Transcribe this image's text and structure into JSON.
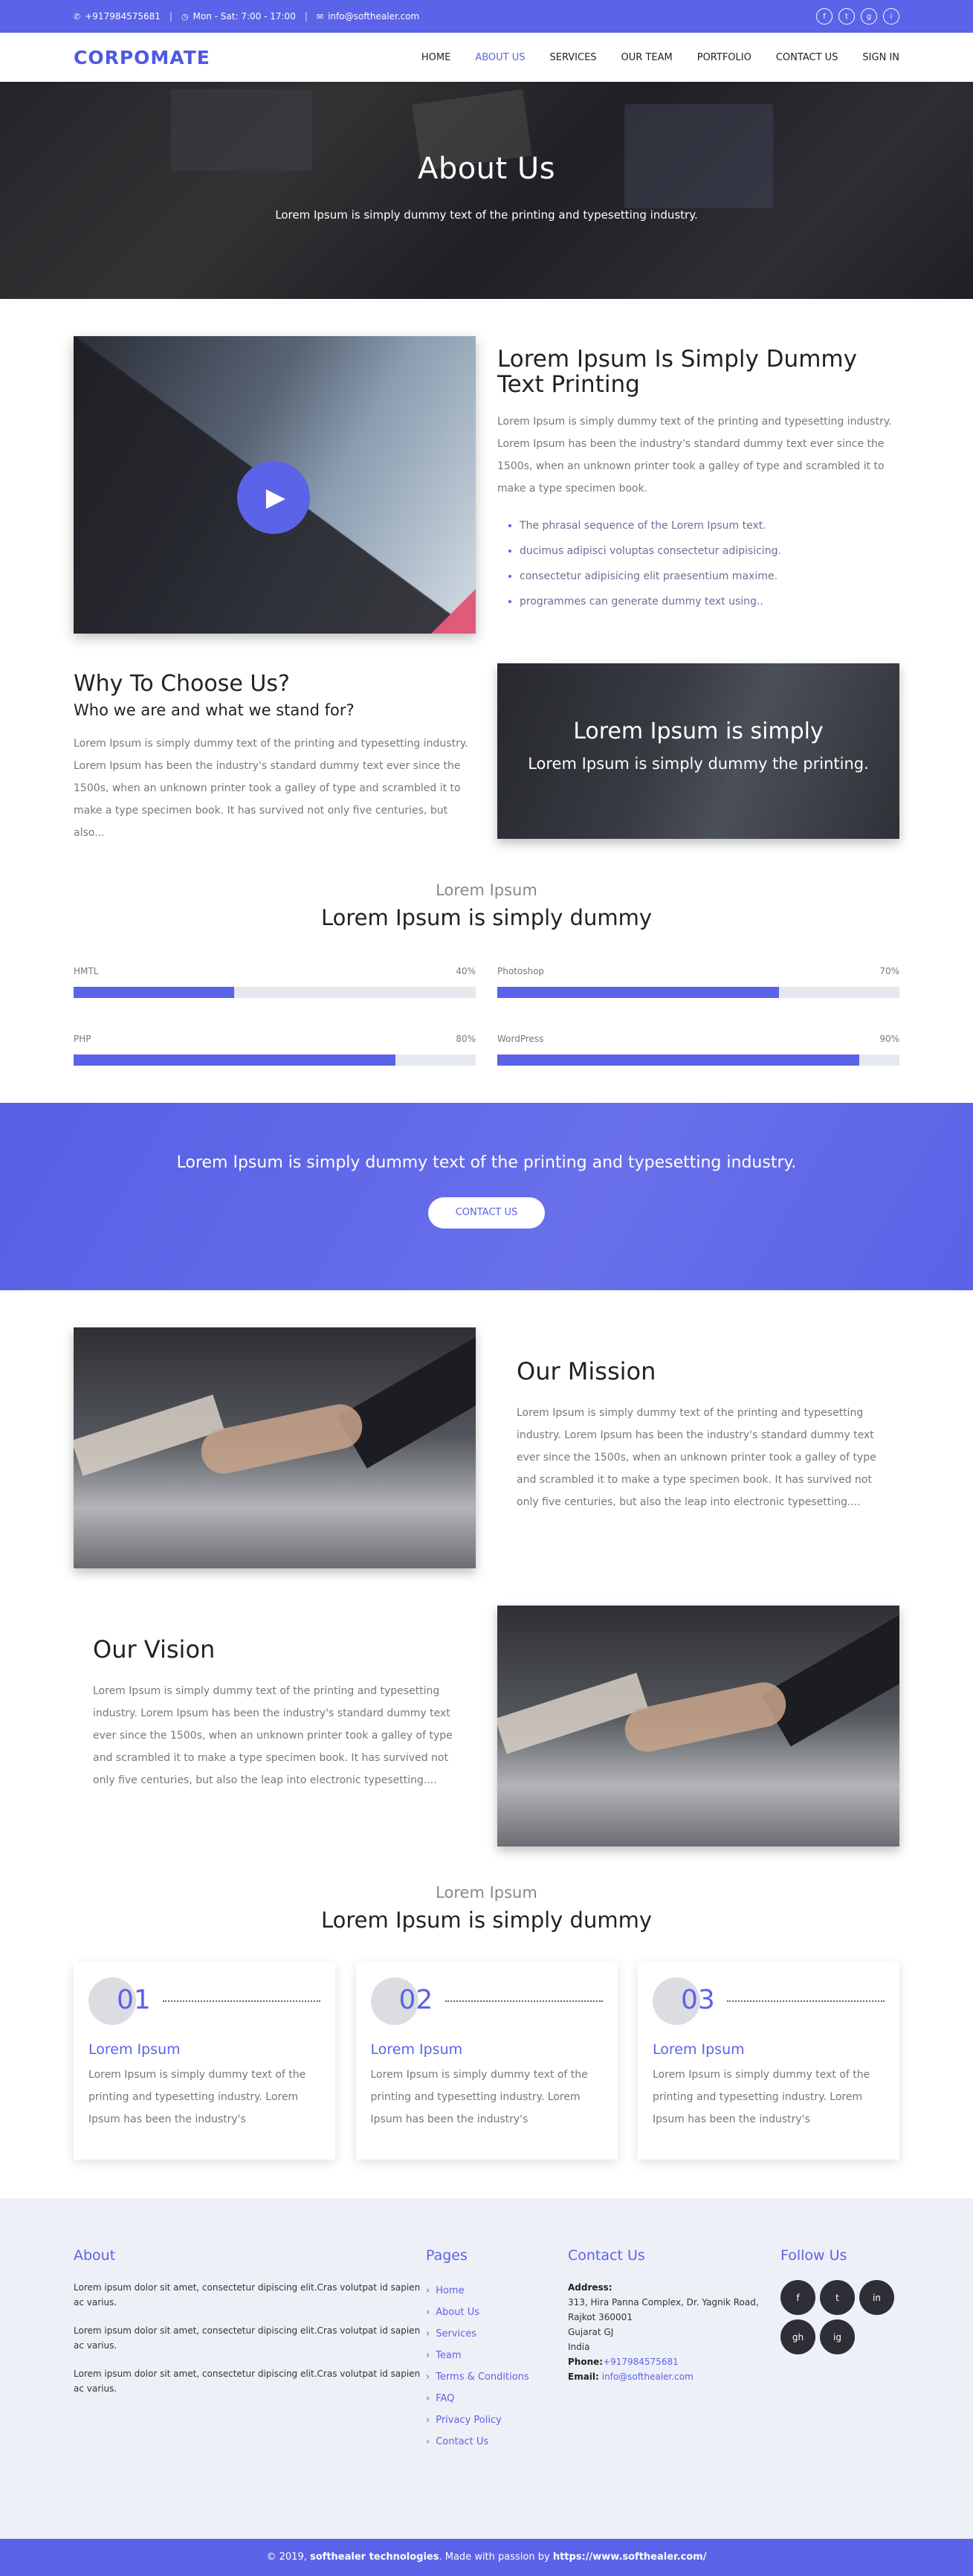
{
  "topbar": {
    "phone": "+917984575681",
    "hours": "Mon - Sat: 7:00 - 17:00",
    "email": "info@softhealer.com",
    "social": [
      "f",
      "t",
      "g",
      "i"
    ]
  },
  "nav": {
    "logo": "CORPOMATE",
    "links": [
      "HOME",
      "ABOUT US",
      "SERVICES",
      "OUR TEAM",
      "PORTFOLIO",
      "CONTACT US",
      "SIGN IN"
    ],
    "active": "ABOUT US"
  },
  "hero": {
    "title": "About Us",
    "subtitle": "Lorem Ipsum is simply dummy text of the printing and typesetting industry."
  },
  "intro": {
    "title": "Lorem Ipsum Is Simply Dummy Text Printing",
    "body": "Lorem Ipsum is simply dummy text of the printing and typesetting industry. Lorem Ipsum has been the industry's standard dummy text ever since the 1500s, when an unknown printer took a galley of type and scrambled it to make a type specimen book.",
    "bullets": [
      "The phrasal sequence of the Lorem Ipsum text.",
      "ducimus adipisci voluptas consectetur adipisicing.",
      "consectetur adipisicing elit praesentium maxime.",
      "programmes can generate dummy text using.."
    ]
  },
  "why": {
    "title": "Why To Choose Us?",
    "subtitle": "Who we are and what we stand for?",
    "body": "Lorem Ipsum is simply dummy text of the printing and typesetting industry. Lorem Ipsum has been the industry's standard dummy text ever since the 1500s, when an unknown printer took a galley of type and scrambled it to make a type specimen book. It has survived not only five centuries, but also...",
    "image_title": "Lorem Ipsum is simply",
    "image_subtitle": "Lorem Ipsum is simply dummy the printing."
  },
  "skills": {
    "subtitle": "Lorem Ipsum",
    "title": "Lorem Ipsum is simply dummy",
    "items": [
      {
        "name": "HMTL",
        "label": "40%",
        "value": 40
      },
      {
        "name": "Photoshop",
        "label": "70%",
        "value": 70
      },
      {
        "name": "PHP",
        "label": "80%",
        "value": 80
      },
      {
        "name": "WordPress",
        "label": "90%",
        "value": 90
      }
    ]
  },
  "cta": {
    "text": "Lorem Ipsum is simply dummy text of the printing and typesetting industry.",
    "button": "CONTACT US"
  },
  "mission": {
    "title": "Our Mission",
    "body": "Lorem Ipsum is simply dummy text of the printing and typesetting industry. Lorem Ipsum has been the industry's standard dummy text ever since the 1500s, when an unknown printer took a galley of type and scrambled it to make a type specimen book. It has survived not only five centuries, but also the leap into electronic typesetting...."
  },
  "vision": {
    "title": "Our Vision",
    "body": "Lorem Ipsum is simply dummy text of the printing and typesetting industry. Lorem Ipsum has been the industry's standard dummy text ever since the 1500s, when an unknown printer took a galley of type and scrambled it to make a type specimen book. It has survived not only five centuries, but also the leap into electronic typesetting...."
  },
  "steps": {
    "subtitle": "Lorem Ipsum",
    "title": "Lorem Ipsum is simply dummy",
    "items": [
      {
        "num": "01",
        "title": "Lorem Ipsum",
        "body": "Lorem Ipsum is simply dummy text of the printing and typesetting industry. Lorem Ipsum has been the industry's"
      },
      {
        "num": "02",
        "title": "Lorem Ipsum",
        "body": "Lorem Ipsum is simply dummy text of the printing and typesetting industry. Lorem Ipsum has been the industry's"
      },
      {
        "num": "03",
        "title": "Lorem Ipsum",
        "body": "Lorem Ipsum is simply dummy text of the printing and typesetting industry. Lorem Ipsum has been the industry's"
      }
    ]
  },
  "footer": {
    "about_title": "About",
    "about": [
      "Lorem ipsum dolor sit amet, consectetur dipiscing elit.Cras volutpat id sapien ac varius.",
      "Lorem ipsum dolor sit amet, consectetur dipiscing elit.Cras volutpat id sapien ac varius.",
      "Lorem ipsum dolor sit amet, consectetur dipiscing elit.Cras volutpat id sapien ac varius."
    ],
    "pages_title": "Pages",
    "pages": [
      "Home",
      "About Us",
      "Services",
      "Team",
      "Terms & Conditions",
      "FAQ",
      "Privacy Policy",
      "Contact Us"
    ],
    "contact_title": "Contact Us",
    "address_label": "Address:",
    "address_lines": [
      "313, Hira Panna Complex, Dr. Yagnik Road,",
      "Rajkot 360001",
      "Gujarat GJ",
      "India"
    ],
    "phone_label": "Phone:",
    "phone": "+917984575681",
    "email_label": "Email:",
    "email": "info@softhealer.com",
    "follow_title": "Follow Us",
    "social": [
      "f",
      "t",
      "in",
      "gh",
      "ig"
    ]
  },
  "copyright": {
    "prefix": "© 2019,",
    "company": "softhealer technologies",
    "middle": ". Made with passion by",
    "url": "https://www.softhealer.com/"
  },
  "colors": {
    "accent": "#5b63e8",
    "footer_bg": "#eef0f7",
    "social_dark": "#2e2f36"
  }
}
